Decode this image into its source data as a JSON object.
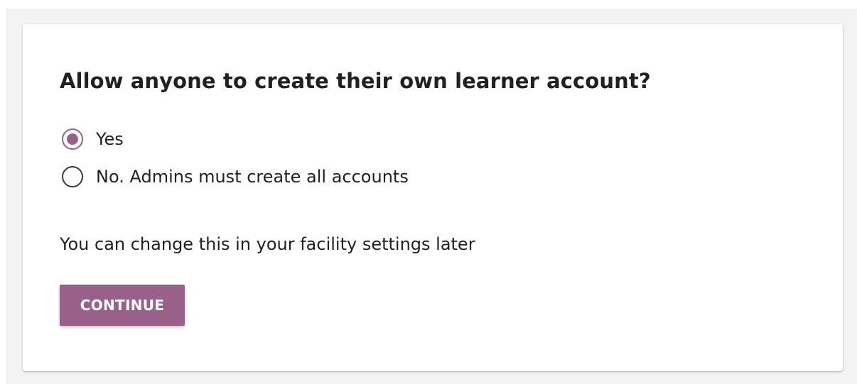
{
  "colors": {
    "accent": "#996189",
    "text": "#212121",
    "page_background": "#f3f3f3",
    "card_background": "#ffffff"
  },
  "form": {
    "question": "Allow anyone to create their own learner account?",
    "options": [
      {
        "label": "Yes",
        "selected": true
      },
      {
        "label": "No. Admins must create all accounts",
        "selected": false
      }
    ],
    "hint": "You can change this in your facility settings later",
    "continue_label": "CONTINUE"
  }
}
